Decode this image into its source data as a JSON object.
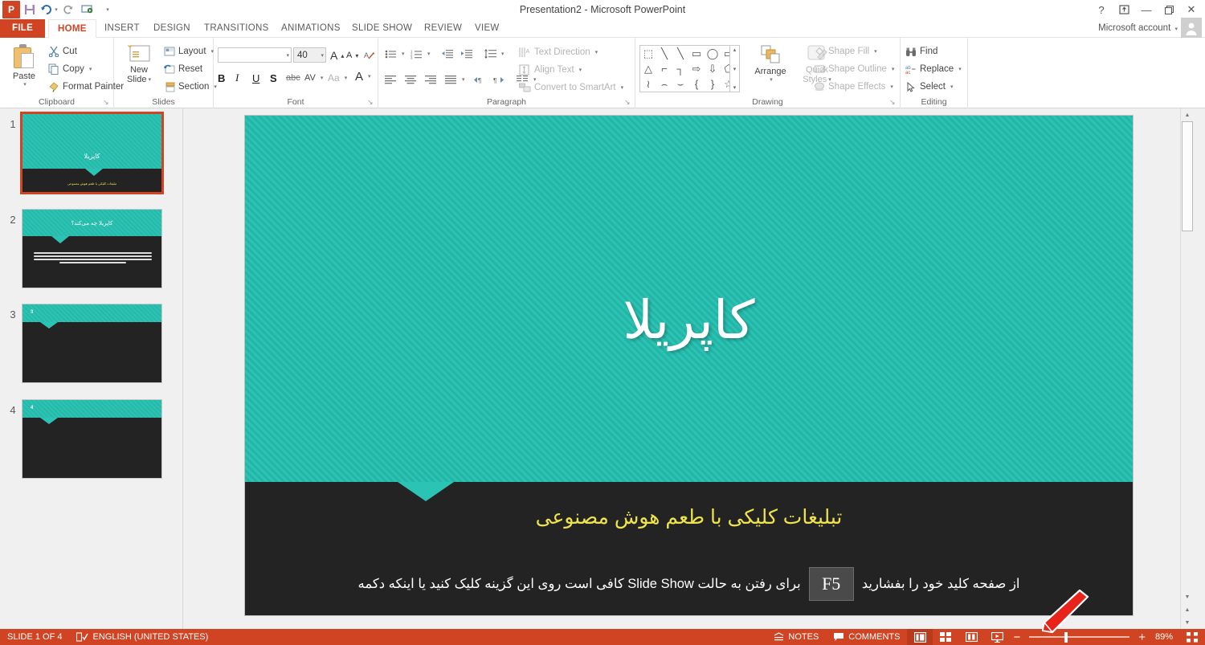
{
  "window": {
    "title": "Presentation2 - Microsoft PowerPoint",
    "account_label": "Microsoft account",
    "help_icon": "help-icon",
    "ribbon_display_icon": "ribbon-display-options-icon",
    "minimize_icon": "minimize-icon",
    "restore_icon": "restore-icon",
    "close_icon": "close-icon"
  },
  "quick_access": {
    "logo": "P",
    "save_icon": "save-icon",
    "undo_icon": "undo-icon",
    "redo_icon": "redo-icon",
    "start_slideshow_icon": "start-from-beginning-icon",
    "customize_icon": "customize-quick-access-toolbar-icon"
  },
  "tabs": [
    {
      "label": "FILE",
      "active": false
    },
    {
      "label": "HOME",
      "active": true
    },
    {
      "label": "INSERT",
      "active": false
    },
    {
      "label": "DESIGN",
      "active": false
    },
    {
      "label": "TRANSITIONS",
      "active": false
    },
    {
      "label": "ANIMATIONS",
      "active": false
    },
    {
      "label": "SLIDE SHOW",
      "active": false
    },
    {
      "label": "REVIEW",
      "active": false
    },
    {
      "label": "VIEW",
      "active": false
    }
  ],
  "ribbon": {
    "collapse_caret": "▲",
    "groups": {
      "clipboard": {
        "label": "Clipboard",
        "paste": "Paste",
        "cut": "Cut",
        "copy": "Copy",
        "format_painter": "Format Painter",
        "dialog_launcher": "↘"
      },
      "slides": {
        "label": "Slides",
        "new_slide_line1": "New",
        "new_slide_line2": "Slide",
        "layout": "Layout",
        "reset": "Reset",
        "section": "Section"
      },
      "font": {
        "label": "Font",
        "font_name": "",
        "font_name_placeholder": "",
        "font_size": "40",
        "grow_font": "A",
        "shrink_font": "A",
        "clear_formatting": "clear-formatting-icon",
        "bold": "B",
        "italic": "I",
        "underline": "U",
        "shadow": "S",
        "strikethrough": "abc",
        "character_spacing": "AV",
        "change_case": "Aa",
        "font_color": "A",
        "dialog_launcher": "↘"
      },
      "paragraph": {
        "label": "Paragraph",
        "text_direction": "Text Direction",
        "align_text": "Align Text",
        "convert_to_smartart": "Convert to SmartArt",
        "dialog_launcher": "↘"
      },
      "drawing": {
        "label": "Drawing",
        "shapes": [
          "⬚",
          "╲",
          "╲",
          "▭",
          "◯",
          "▭",
          "△",
          "⌐",
          "┐",
          "⇨",
          "⇩",
          "⬠",
          "≀",
          "⌢",
          "⌣",
          "{",
          "}",
          "☆"
        ],
        "arrange": "Arrange",
        "quick_styles_line1": "Quick",
        "quick_styles_line2": "Styles",
        "shape_fill": "Shape Fill",
        "shape_outline": "Shape Outline",
        "shape_effects": "Shape Effects",
        "dialog_launcher": "↘"
      },
      "editing": {
        "label": "Editing",
        "find": "Find",
        "replace": "Replace",
        "select": "Select"
      }
    }
  },
  "thumbnails": [
    {
      "number": "1",
      "selected": true,
      "title": "کاپریلا",
      "subtitle": "تبلیغات کلیکی با طعم هوش مصنوعی",
      "layout": "title-slide"
    },
    {
      "number": "2",
      "selected": false,
      "title": "کاپریلا چه می‌کند؟",
      "subtitle": "",
      "layout": "title-and-content"
    },
    {
      "number": "3",
      "selected": false,
      "title": "3",
      "subtitle": "",
      "layout": "header-only"
    },
    {
      "number": "4",
      "selected": false,
      "title": "4",
      "subtitle": "",
      "layout": "header-only"
    }
  ],
  "slide": {
    "title": "کاپریلا",
    "subtitle": "تبلیغات کلیکی با طعم هوش مصنوعی",
    "note_right": "برای رفتن به حالت  Slide Show  کافی است روی این گزینه کلیک کنید یا اینکه دکمه",
    "note_key": "F5",
    "note_left": "از صفحه کلید خود را بفشارید",
    "colors": {
      "teal": "#2bc4b4",
      "dark": "#232323",
      "yellow": "#efe44a"
    }
  },
  "status_bar": {
    "slide_count": "SLIDE 1 OF 4",
    "proofing_icon": "spell-check-icon",
    "language": "ENGLISH (UNITED STATES)",
    "notes": "NOTES",
    "notes_icon": "notes-icon",
    "comments": "COMMENTS",
    "comments_icon": "comments-icon",
    "view_normal_icon": "normal-view-icon",
    "view_sorter_icon": "slide-sorter-icon",
    "view_reading_icon": "reading-view-icon",
    "view_slideshow_icon": "slide-show-icon",
    "zoom_out_icon": "zoom-out-icon",
    "zoom_in_icon": "zoom-in-icon",
    "zoom_percent": "89%",
    "fit_icon": "fit-slide-to-window-icon"
  },
  "annotation": {
    "pen_icon": "red-arrow-annotation"
  }
}
